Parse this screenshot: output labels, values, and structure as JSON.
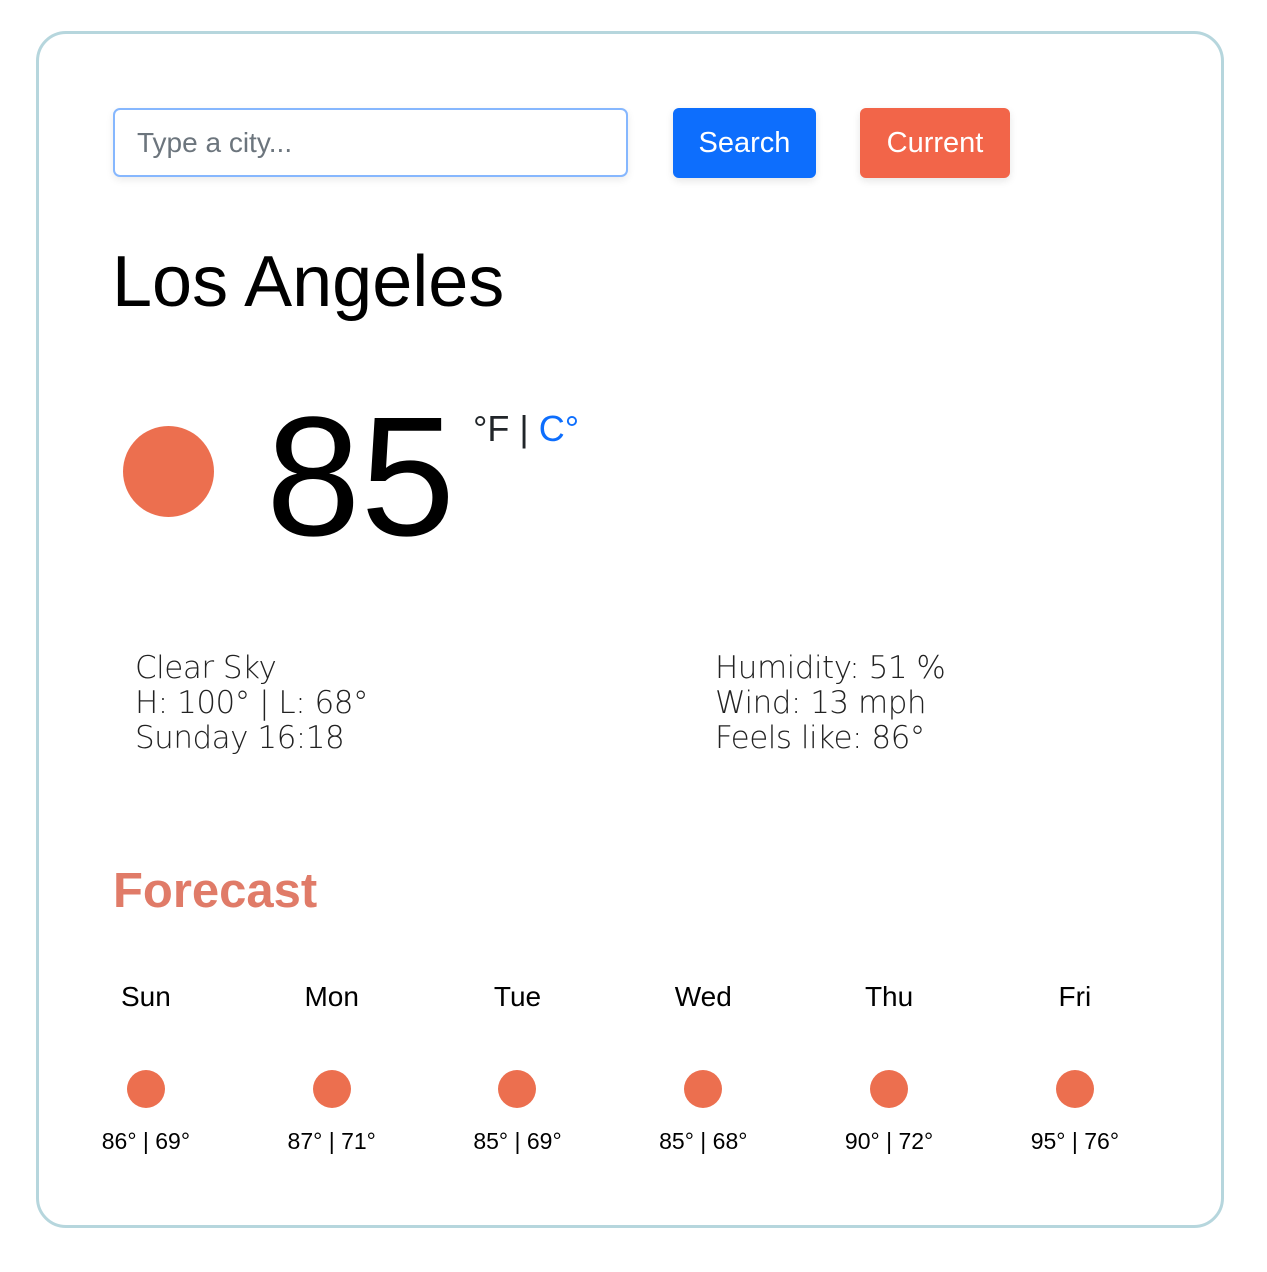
{
  "search": {
    "placeholder": "Type a city...",
    "value": "",
    "search_label": "Search",
    "current_label": "Current"
  },
  "weather": {
    "city": "Los Angeles",
    "icon": "sun-icon",
    "temperature": "85",
    "unit_f": "°F",
    "unit_separator": "|",
    "unit_c": "C°",
    "description": "Clear Sky",
    "high_low": "H: 100° | L: 68°",
    "datetime": "Sunday 16:18",
    "humidity": "Humidity: 51 %",
    "wind": "Wind: 13 mph",
    "feels_like": "Feels like: 86°"
  },
  "forecast": {
    "title": "Forecast",
    "days": [
      {
        "day": "Sun",
        "icon": "sun-icon",
        "temps": "86° | 69°"
      },
      {
        "day": "Mon",
        "icon": "sun-icon",
        "temps": "87° | 71°"
      },
      {
        "day": "Tue",
        "icon": "sun-icon",
        "temps": "85° | 69°"
      },
      {
        "day": "Wed",
        "icon": "sun-icon",
        "temps": "85° | 68°"
      },
      {
        "day": "Thu",
        "icon": "sun-icon",
        "temps": "90° | 72°"
      },
      {
        "day": "Fri",
        "icon": "sun-icon",
        "temps": "95° | 76°"
      }
    ]
  },
  "colors": {
    "search_button": "#0d6efd",
    "current_button": "#f26549",
    "sun_icon": "#ec6f4f",
    "forecast_title": "#e07b68",
    "celsius_link": "#0d6efd",
    "card_border": "#b6d6dd"
  }
}
